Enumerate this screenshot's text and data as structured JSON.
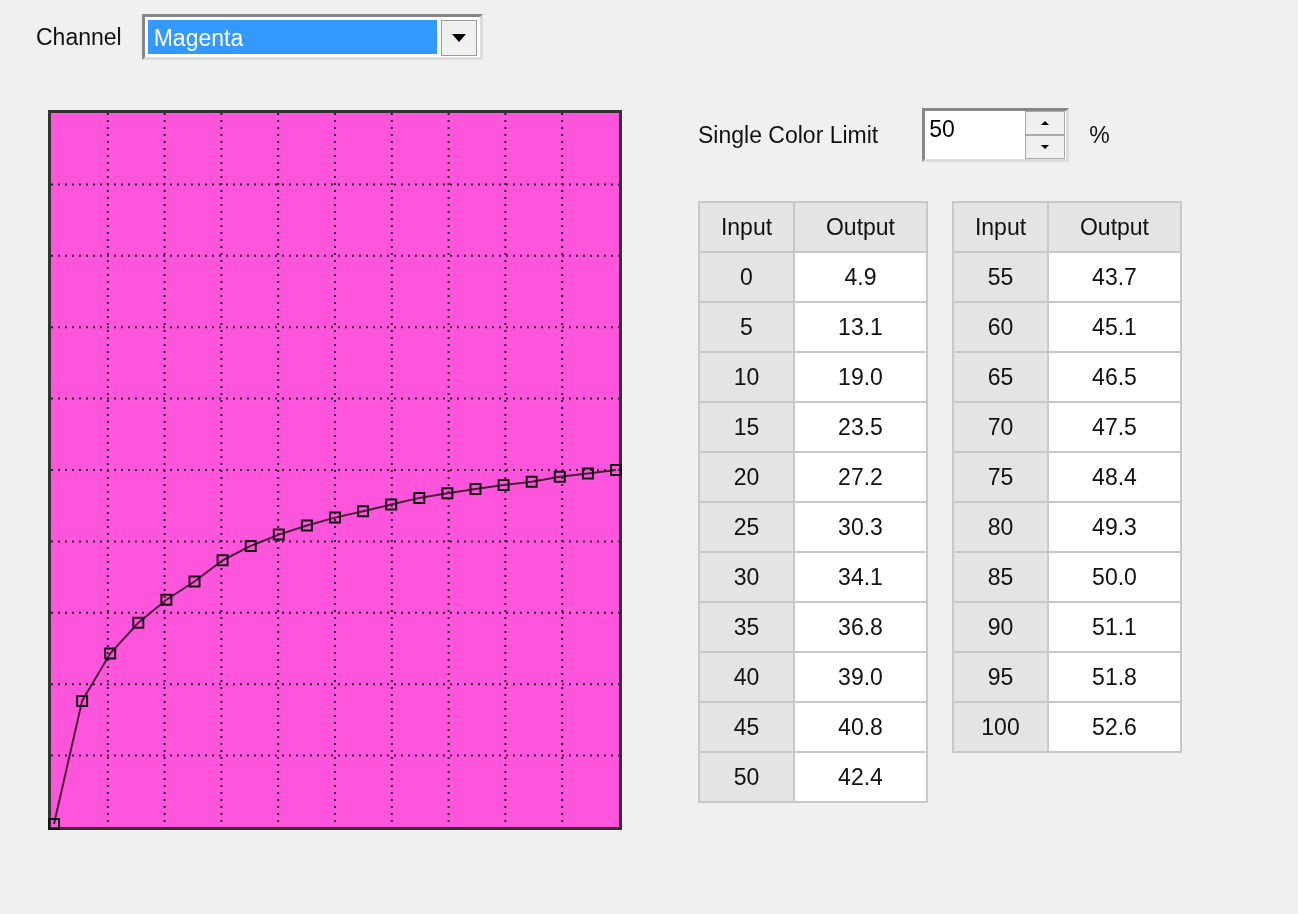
{
  "channel": {
    "label": "Channel",
    "value": "Magenta"
  },
  "single_color_limit": {
    "label": "Single Color Limit",
    "value": "50",
    "unit": "%"
  },
  "tables": [
    {
      "columns": [
        "Input",
        "Output"
      ],
      "rows": [
        [
          "0",
          "4.9"
        ],
        [
          "5",
          "13.1"
        ],
        [
          "10",
          "19.0"
        ],
        [
          "15",
          "23.5"
        ],
        [
          "20",
          "27.2"
        ],
        [
          "25",
          "30.3"
        ],
        [
          "30",
          "34.1"
        ],
        [
          "35",
          "36.8"
        ],
        [
          "40",
          "39.0"
        ],
        [
          "45",
          "40.8"
        ],
        [
          "50",
          "42.4"
        ]
      ]
    },
    {
      "columns": [
        "Input",
        "Output"
      ],
      "rows": [
        [
          "55",
          "43.7"
        ],
        [
          "60",
          "45.1"
        ],
        [
          "65",
          "46.5"
        ],
        [
          "70",
          "47.5"
        ],
        [
          "75",
          "48.4"
        ],
        [
          "80",
          "49.3"
        ],
        [
          "85",
          "50.0"
        ],
        [
          "90",
          "51.1"
        ],
        [
          "95",
          "51.8"
        ],
        [
          "100",
          "52.6"
        ]
      ]
    }
  ]
}
